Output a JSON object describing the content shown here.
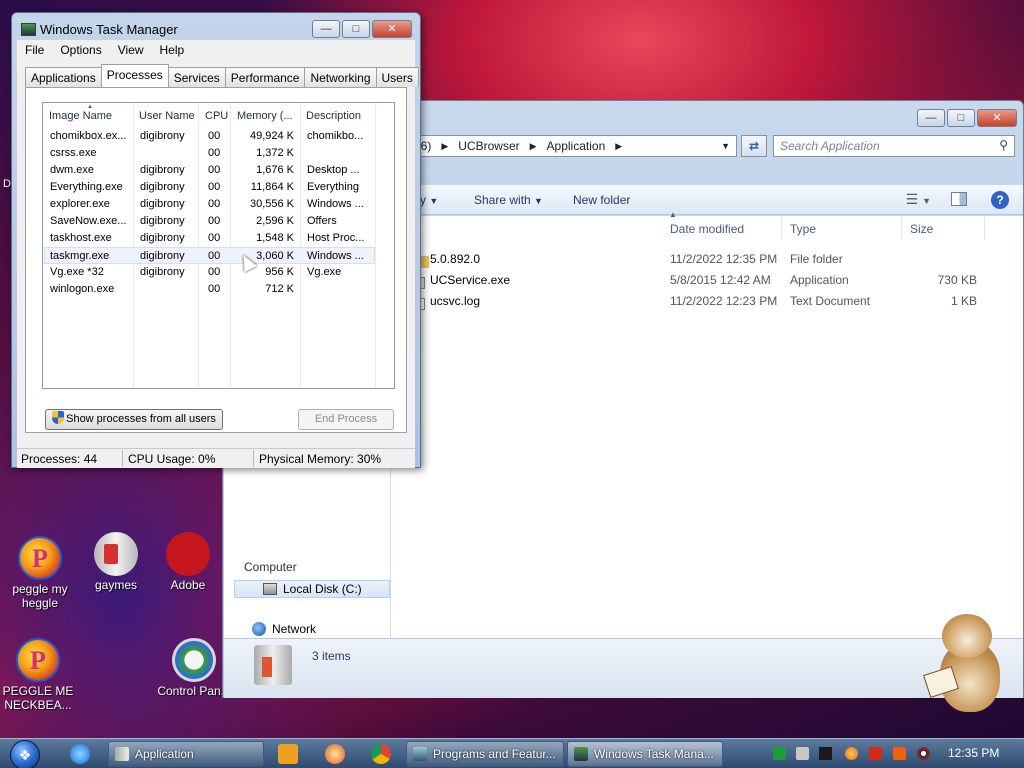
{
  "desktop": {
    "stray_letter": "D",
    "icons": [
      {
        "label": "peggle my heggle",
        "icon": "peggle-icon"
      },
      {
        "label": "gaymes",
        "icon": "folder-icon"
      },
      {
        "label": "Adobe",
        "icon": "adobe-reader-icon"
      },
      {
        "label": "PEGGLE ME NECKBEA...",
        "icon": "peggle-icon"
      },
      {
        "label": "Control Pan...",
        "icon": "control-panel-icon"
      }
    ]
  },
  "explorer": {
    "breadcrumb": [
      "x86)",
      "UCBrowser",
      "Application"
    ],
    "search_placeholder": "Search Application",
    "toolbar": {
      "partial_label": "y",
      "share_with": "Share with",
      "new_folder": "New folder",
      "help": "?"
    },
    "columns": [
      "Date modified",
      "Type",
      "Size"
    ],
    "files": [
      {
        "name": "5.0.892.0",
        "date": "11/2/2022 12:35 PM",
        "type": "File folder",
        "size": "",
        "icon": "folder-icon"
      },
      {
        "name": "UCService.exe",
        "date": "5/8/2015 12:42 AM",
        "type": "Application",
        "size": "730 KB",
        "icon": "exe-icon"
      },
      {
        "name": "ucsvc.log",
        "date": "11/2/2022 12:23 PM",
        "type": "Text Document",
        "size": "1 KB",
        "icon": "text-file-icon"
      }
    ],
    "nav": {
      "computer_partial": "Computer",
      "local_disk": "Local Disk (C:)",
      "network": "Network"
    },
    "details": {
      "item_count": "3 items"
    }
  },
  "task_manager": {
    "title": "Windows Task Manager",
    "menu": [
      "File",
      "Options",
      "View",
      "Help"
    ],
    "tabs": [
      "Applications",
      "Processes",
      "Services",
      "Performance",
      "Networking",
      "Users"
    ],
    "active_tab": "Processes",
    "columns": [
      "Image Name",
      "User Name",
      "CPU",
      "Memory (...",
      "Description"
    ],
    "processes": [
      {
        "image": "chomikbox.ex...",
        "user": "digibrony",
        "cpu": "00",
        "mem": "49,924 K",
        "desc": "chomikbo..."
      },
      {
        "image": "csrss.exe",
        "user": "",
        "cpu": "00",
        "mem": "1,372 K",
        "desc": ""
      },
      {
        "image": "dwm.exe",
        "user": "digibrony",
        "cpu": "00",
        "mem": "1,676 K",
        "desc": "Desktop ..."
      },
      {
        "image": "Everything.exe",
        "user": "digibrony",
        "cpu": "00",
        "mem": "11,864 K",
        "desc": "Everything"
      },
      {
        "image": "explorer.exe",
        "user": "digibrony",
        "cpu": "00",
        "mem": "30,556 K",
        "desc": "Windows ..."
      },
      {
        "image": "SaveNow.exe...",
        "user": "digibrony",
        "cpu": "00",
        "mem": "2,596 K",
        "desc": "Offers"
      },
      {
        "image": "taskhost.exe",
        "user": "digibrony",
        "cpu": "00",
        "mem": "1,548 K",
        "desc": "Host Proc..."
      },
      {
        "image": "taskmgr.exe",
        "user": "digibrony",
        "cpu": "00",
        "mem": "3,060 K",
        "desc": "Windows ..."
      },
      {
        "image": "Vg.exe *32",
        "user": "digibrony",
        "cpu": "00",
        "mem": "956 K",
        "desc": "Vg.exe"
      },
      {
        "image": "winlogon.exe",
        "user": "",
        "cpu": "00",
        "mem": "712 K",
        "desc": ""
      }
    ],
    "selected_process": "taskmgr.exe",
    "show_all_button": "Show processes from all users",
    "end_process_button": "End Process",
    "status": {
      "processes": "Processes: 44",
      "cpu": "CPU Usage: 0%",
      "memory": "Physical Memory: 30%"
    }
  },
  "taskbar": {
    "buttons": [
      {
        "label": "Application",
        "icon": "explorer-folder-icon"
      },
      {
        "label": "Programs and Featur...",
        "icon": "programs-icon"
      },
      {
        "label": "Windows Task Mana...",
        "icon": "task-manager-icon"
      }
    ],
    "pinned": [
      "internet-explorer-icon",
      "media-player-icon",
      "paint-icon",
      "chrome-icon"
    ],
    "tray": [
      "green-app-icon",
      "network-icon",
      "check-icon",
      "search-tray-icon",
      "flag-icon",
      "orange-app-icon",
      "volume-icon"
    ],
    "clock": "12:35 PM"
  }
}
